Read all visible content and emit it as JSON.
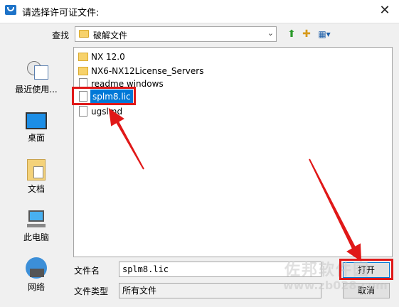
{
  "window": {
    "title": "请选择许可证文件:",
    "close_glyph": "✕"
  },
  "lookin": {
    "label": "查找",
    "value": "破解文件",
    "arrow": "⌄"
  },
  "toolbar": {
    "up_glyph": "⬆",
    "newfolder_glyph": "✚",
    "view_glyph": "▦▾"
  },
  "places": [
    {
      "label": "最近使用..."
    },
    {
      "label": "桌面"
    },
    {
      "label": "文档"
    },
    {
      "label": "此电脑"
    },
    {
      "label": "网络"
    }
  ],
  "files": [
    {
      "name": "NX 12.0",
      "type": "folder"
    },
    {
      "name": "NX6-NX12License_Servers",
      "type": "folder"
    },
    {
      "name": "readme windows",
      "type": "file"
    },
    {
      "name": "splm8.lic",
      "type": "file",
      "selected": true
    },
    {
      "name": "ugslmd",
      "type": "file"
    }
  ],
  "filename": {
    "label": "文件名",
    "value": "splm8.lic"
  },
  "filetype": {
    "label": "文件类型",
    "value": "所有文件"
  },
  "buttons": {
    "open": "打开",
    "cancel": "取消"
  },
  "watermark": {
    "line1": "佐邦软件园",
    "line2": "www.zb028.com"
  },
  "colors": {
    "highlight": "#e01818",
    "selection": "#0078d7"
  }
}
